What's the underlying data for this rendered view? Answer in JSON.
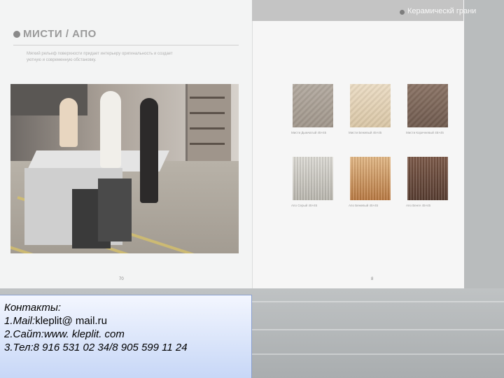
{
  "brochure": {
    "brand_label": "Керамическй грани",
    "collection_title": "МИСТИ / АПО",
    "description": "Мягкий рельеф поверхности придает интерьеру оригинальность и создает уютную и современную обстановку.",
    "left_page_number": "70",
    "right_page_number": "8",
    "swatches": [
      {
        "caption": "Мисти Дымчатый 45×45",
        "colors": [
          "#b3aaa0",
          "#a0968b"
        ]
      },
      {
        "caption": "Мисти Бежевый 45×45",
        "colors": [
          "#ebdcc4",
          "#d9c6a6"
        ]
      },
      {
        "caption": "Мисти Коричневый 45×45",
        "colors": [
          "#8b7466",
          "#6f5a4e"
        ]
      },
      {
        "caption": "Апо Серый 45×45",
        "colors": [
          "#dcdad4",
          "#b9b6ae"
        ]
      },
      {
        "caption": "Апо Бежевый 45×45",
        "colors": [
          "#e2b784",
          "#b87840"
        ]
      },
      {
        "caption": "Апо Венге 45×45",
        "colors": [
          "#7a5746",
          "#553a2e"
        ]
      }
    ]
  },
  "contacts": {
    "heading": "Контакты:",
    "mail_label": "1.Mail:",
    "mail_value": "kleplit@ mail.ru",
    "site_label": "2.Сайт:",
    "site_value": "www. kleplit. com",
    "phone_label": "3.Тел:",
    "phone_value": "8 916 531 02 34/8 905 599 11 24"
  }
}
